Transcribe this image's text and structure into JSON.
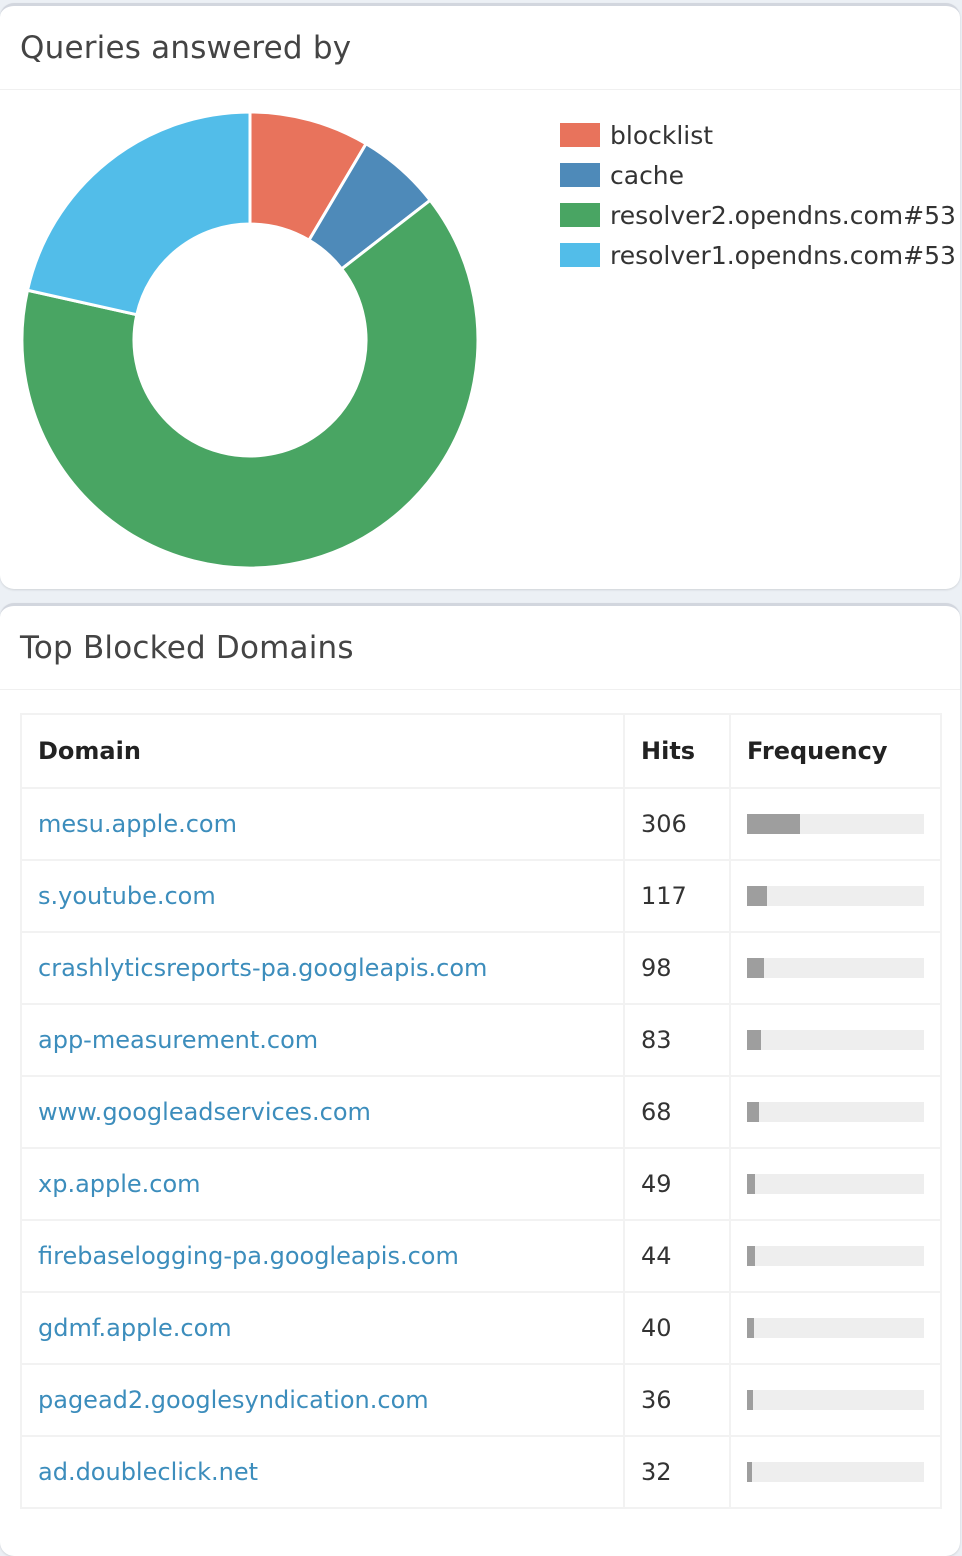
{
  "queries_box": {
    "title": "Queries answered by",
    "chart_data": {
      "type": "pie",
      "donut": true,
      "legend_position": "top-right",
      "series": [
        {
          "name": "blocklist",
          "value": 8.5,
          "color": "#e8735c"
        },
        {
          "name": "cache",
          "value": 6.0,
          "color": "#4e8ab9"
        },
        {
          "name": "resolver2.opendns.com#53",
          "value": 64.0,
          "color": "#49a563"
        },
        {
          "name": "resolver1.opendns.com#53",
          "value": 21.5,
          "color": "#52bde9"
        }
      ]
    }
  },
  "blocked_box": {
    "title": "Top Blocked Domains",
    "columns": {
      "domain": "Domain",
      "hits": "Hits",
      "frequency": "Frequency"
    },
    "rows": [
      {
        "domain": "mesu.apple.com",
        "hits": "306",
        "frequency": 0.3
      },
      {
        "domain": "s.youtube.com",
        "hits": "117",
        "frequency": 0.115
      },
      {
        "domain": "crashlyticsreports-pa.googleapis.com",
        "hits": "98",
        "frequency": 0.096
      },
      {
        "domain": "app-measurement.com",
        "hits": "83",
        "frequency": 0.081
      },
      {
        "domain": "www.googleadservices.com",
        "hits": "68",
        "frequency": 0.067
      },
      {
        "domain": "xp.apple.com",
        "hits": "49",
        "frequency": 0.048
      },
      {
        "domain": "firebaselogging-pa.googleapis.com",
        "hits": "44",
        "frequency": 0.043
      },
      {
        "domain": "gdmf.apple.com",
        "hits": "40",
        "frequency": 0.039
      },
      {
        "domain": "pagead2.googlesyndication.com",
        "hits": "36",
        "frequency": 0.035
      },
      {
        "domain": "ad.doubleclick.net",
        "hits": "32",
        "frequency": 0.031
      }
    ]
  }
}
